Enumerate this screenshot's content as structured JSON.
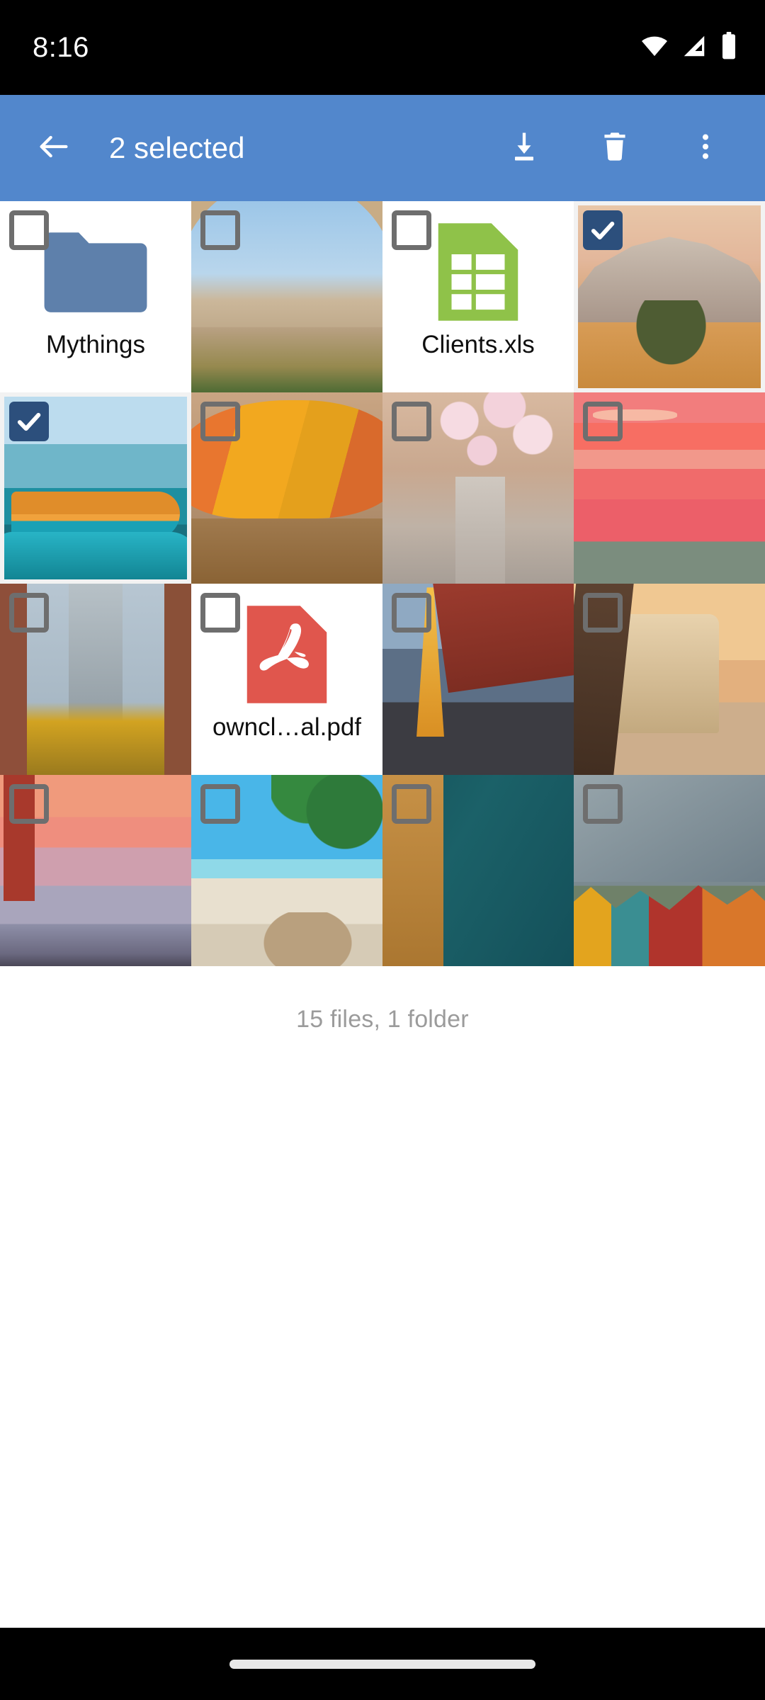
{
  "status_bar": {
    "clock": "8:16",
    "icons": [
      "wifi-icon",
      "cellular-signal-icon",
      "battery-icon"
    ]
  },
  "app_bar": {
    "back_icon": "arrow-back-icon",
    "title": "2 selected",
    "actions": [
      {
        "name": "download-button",
        "icon": "download-icon"
      },
      {
        "name": "delete-button",
        "icon": "trash-icon"
      },
      {
        "name": "overflow-menu-button",
        "icon": "more-vertical-icon"
      }
    ],
    "background_color": "#5287cc"
  },
  "colors": {
    "accent": "#5287cc",
    "checkbox_checked": "#2c4f7c",
    "checkbox_unchecked_border": "#6e6e6e",
    "folder": "#5e80ab",
    "xls_green": "#8fc249",
    "pdf_red": "#e0564d",
    "footer_text": "#9b9b9b"
  },
  "grid": {
    "columns": 4,
    "items": [
      {
        "kind": "folder",
        "name": "Mythings",
        "selected": false,
        "thumb": null,
        "icon": "folder-icon"
      },
      {
        "kind": "image",
        "name": "",
        "selected": false,
        "thumb": "im-alhambra"
      },
      {
        "kind": "xls",
        "name": "Clients.xls",
        "selected": false,
        "thumb": null,
        "icon": "spreadsheet-icon"
      },
      {
        "kind": "image",
        "name": "",
        "selected": true,
        "thumb": "im-kili"
      },
      {
        "kind": "image",
        "name": "",
        "selected": true,
        "thumb": "im-harbor"
      },
      {
        "kind": "image",
        "name": "",
        "selected": false,
        "thumb": "im-gecko"
      },
      {
        "kind": "image",
        "name": "",
        "selected": false,
        "thumb": "im-kyoto"
      },
      {
        "kind": "image",
        "name": "",
        "selected": false,
        "thumb": "im-pinksea"
      },
      {
        "kind": "image",
        "name": "",
        "selected": false,
        "thumb": "im-nyc"
      },
      {
        "kind": "pdf",
        "name": "owncl…al.pdf",
        "selected": false,
        "thumb": null,
        "icon": "pdf-icon"
      },
      {
        "kind": "image",
        "name": "",
        "selected": false,
        "thumb": "im-eiffel"
      },
      {
        "kind": "image",
        "name": "",
        "selected": false,
        "thumb": "im-colo"
      },
      {
        "kind": "image",
        "name": "",
        "selected": false,
        "thumb": "im-gg"
      },
      {
        "kind": "image",
        "name": "",
        "selected": false,
        "thumb": "im-beach"
      },
      {
        "kind": "image",
        "name": "",
        "selected": false,
        "thumb": "im-aerial"
      },
      {
        "kind": "image",
        "name": "",
        "selected": false,
        "thumb": "im-fjord"
      }
    ]
  },
  "footer": {
    "count_text": "15 files, 1 folder"
  },
  "nav_bar": {
    "gesture_pill": "home-gesture-pill"
  }
}
